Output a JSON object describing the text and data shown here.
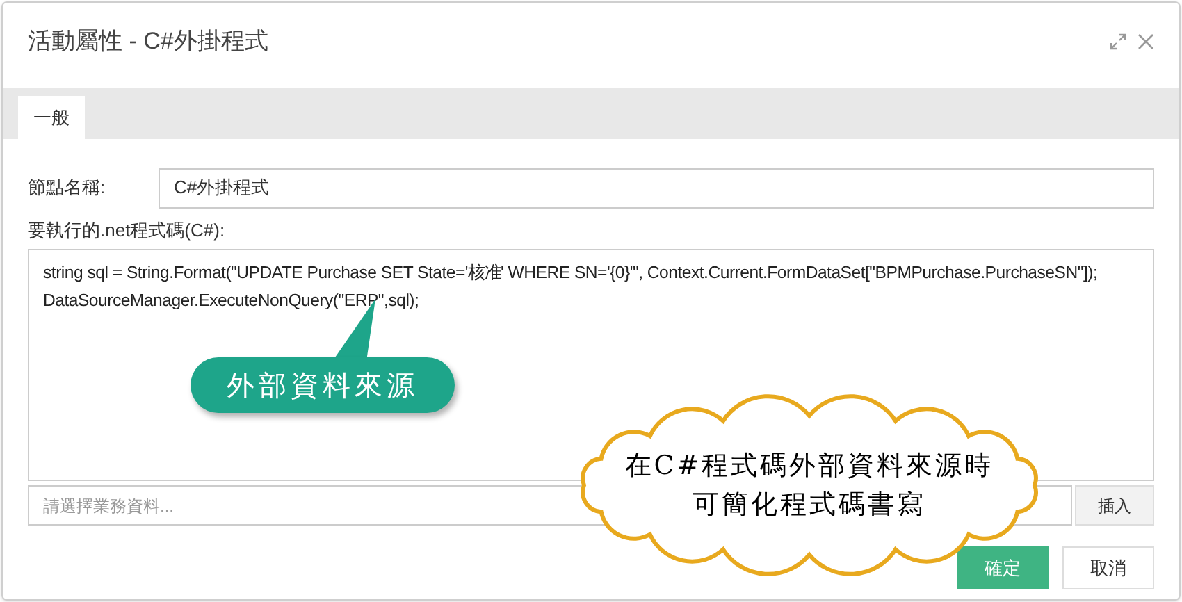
{
  "window": {
    "title": "活動屬性 - C#外掛程式"
  },
  "tabs": [
    {
      "label": "一般",
      "selected": true
    }
  ],
  "node_name": {
    "label": "節點名稱:",
    "value": "C#外掛程式"
  },
  "code": {
    "label": "要執行的.net程式碼(C#):",
    "lines": [
      "string sql = String.Format(\"UPDATE Purchase SET State='核准' WHERE SN='{0}'\", Context.Current.FormDataSet[\"BPMPurchase.PurchaseSN\"]);",
      "DataSourceManager.ExecuteNonQuery(\"ERP\",sql);"
    ]
  },
  "business_data": {
    "placeholder": "請選擇業務資料...",
    "button": "插入"
  },
  "buttons": [
    {
      "label": "確定",
      "kind": "primary"
    },
    {
      "label": "取消",
      "kind": "secondary"
    }
  ],
  "annotations": [
    {
      "kind": "pill",
      "lines": [
        "外部資料來源"
      ]
    },
    {
      "kind": "cloud",
      "lines": [
        "在C#程式碼外部資料來源時",
        "可簡化程式碼書寫"
      ]
    }
  ]
}
